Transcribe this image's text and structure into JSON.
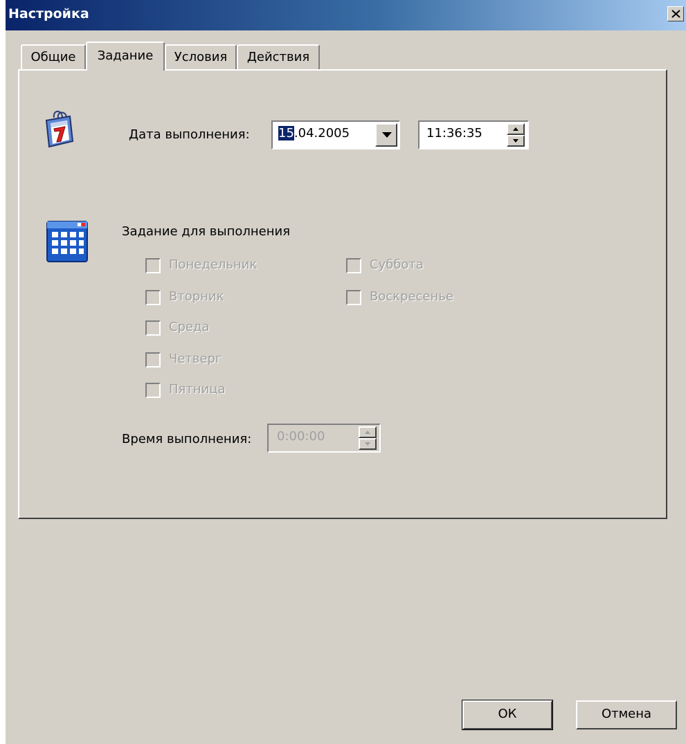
{
  "window": {
    "title": "Настройка"
  },
  "tabs": [
    {
      "label": "Общие",
      "active": false
    },
    {
      "label": "Задание",
      "active": true
    },
    {
      "label": "Условия",
      "active": false
    },
    {
      "label": "Действия",
      "active": false
    }
  ],
  "execution_date": {
    "label": "Дата выполнения:",
    "date_selected": "15",
    "date_rest": ".04.2005",
    "time": "11:36:35"
  },
  "schedule": {
    "heading": "Задание для выполнения",
    "days": [
      {
        "label": "Понедельник",
        "checked": false,
        "enabled": false
      },
      {
        "label": "Вторник",
        "checked": false,
        "enabled": false
      },
      {
        "label": "Среда",
        "checked": false,
        "enabled": false
      },
      {
        "label": "Четверг",
        "checked": false,
        "enabled": false
      },
      {
        "label": "Пятница",
        "checked": false,
        "enabled": false
      },
      {
        "label": "Суббота",
        "checked": false,
        "enabled": false
      },
      {
        "label": "Воскресенье",
        "checked": false,
        "enabled": false
      }
    ],
    "time_label": "Время выполнения:",
    "time_value": "0:00:00"
  },
  "buttons": {
    "ok": "ОК",
    "cancel": "Отмена"
  },
  "icons": {
    "calendar": "calendar-7-icon",
    "schedule": "schedule-grid-icon",
    "dropdown": "dropdown-arrow-icon",
    "close": "close-icon"
  },
  "colors": {
    "face": "#d4d0c8",
    "title_start": "#0a246a",
    "title_end": "#a6caf0",
    "selection": "#0a246a",
    "disabled_text": "#a0a0a0"
  }
}
